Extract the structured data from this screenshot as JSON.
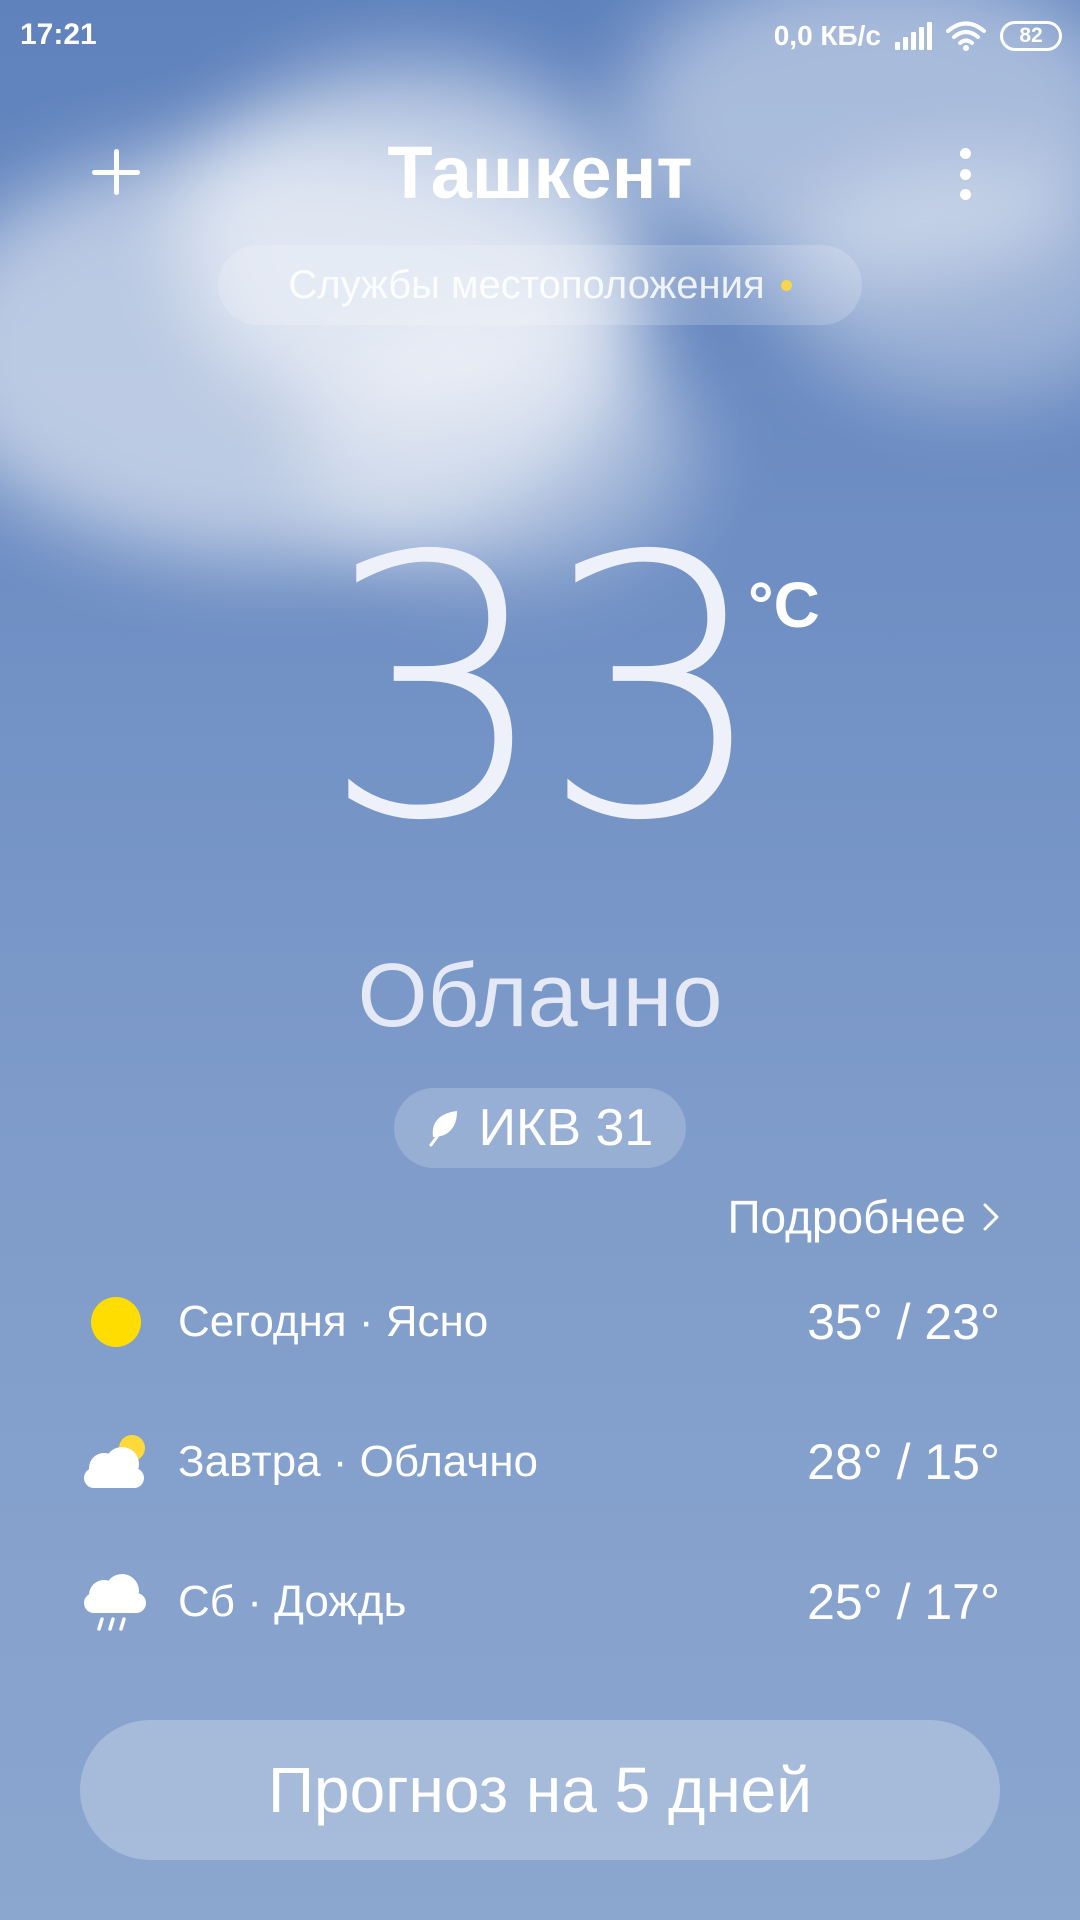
{
  "status_bar": {
    "time": "17:21",
    "net_speed": "0,0 КБ/с",
    "battery": "82",
    "icons": [
      "signal-icon",
      "wifi-icon",
      "battery-icon"
    ]
  },
  "header": {
    "city": "Ташкент",
    "add_icon": "add-icon",
    "more_icon": "more-vertical-icon"
  },
  "location": {
    "label": "Службы местоположения",
    "dot_color": "#f6d64a"
  },
  "current": {
    "temperature": "33",
    "unit": "°C",
    "condition": "Облачно"
  },
  "aqi": {
    "label": "ИКВ 31",
    "icon": "leaf-icon"
  },
  "details_link": "Подробнее",
  "forecast": [
    {
      "icon": "sun-icon",
      "text": "Сегодня · Ясно",
      "temp": "35° / 23°"
    },
    {
      "icon": "partly-cloudy-icon",
      "text": "Завтра · Облачно",
      "temp": "28° / 15°"
    },
    {
      "icon": "rain-icon",
      "text": "Сб · Дождь",
      "temp": "25° / 17°"
    }
  ],
  "forecast_button": "Прогноз на 5 дней",
  "colors": {
    "sky_top": "#5f82bd",
    "sky_bottom": "#8ba6cf",
    "sun": "#ffdd00"
  }
}
